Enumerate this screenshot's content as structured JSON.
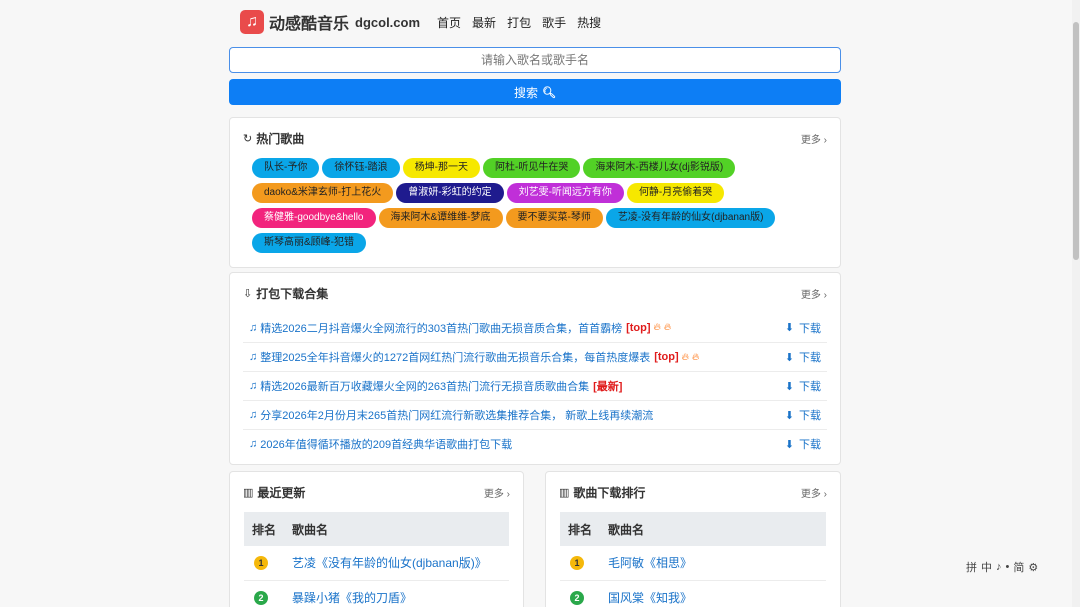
{
  "header": {
    "logo_icon": "music-note-icon",
    "logo_glyph": "♫",
    "site_name": "动感酷音乐",
    "domain": "dgcol.com",
    "nav": [
      "首页",
      "最新",
      "打包",
      "歌手",
      "热搜"
    ]
  },
  "search": {
    "placeholder": "请输入歌名或歌手名",
    "button_label": "搜索"
  },
  "hot_songs": {
    "title": "热门歌曲",
    "more": "更多",
    "tags": [
      {
        "label": "队长-予你",
        "color": "#0aa6e8"
      },
      {
        "label": "徐怀钰-踏浪",
        "color": "#0aa6e8"
      },
      {
        "label": "杨坤-那一天",
        "color": "#f6e800"
      },
      {
        "label": "阿杜-听见牛在哭",
        "color": "#52d126"
      },
      {
        "label": "海来阿木-西楼儿女(dj影锐版)",
        "color": "#52d126"
      },
      {
        "label": "daoko&米津玄师-打上花火",
        "color": "#f39a1e"
      },
      {
        "label": "曾淑妍-彩虹的约定",
        "color": "#1f1b8e"
      },
      {
        "label": "刘艺雯-听闻远方有你",
        "color": "#c02fd8"
      },
      {
        "label": "何静-月亮偷着哭",
        "color": "#f6e800"
      },
      {
        "label": "蔡健雅-goodbye&hello",
        "color": "#f2247d"
      },
      {
        "label": "海来阿木&谭维维-梦底",
        "color": "#f39a1e"
      },
      {
        "label": "要不要买菜-琴师",
        "color": "#f39a1e"
      },
      {
        "label": "艺凌-没有年龄的仙女(djbanan版)",
        "color": "#0aa6e8"
      },
      {
        "label": "斯琴高丽&顾峰-犯错",
        "color": "#0aa6e8"
      }
    ]
  },
  "packs": {
    "title": "打包下载合集",
    "more": "更多",
    "download_label": "下载",
    "items": [
      {
        "title": "精选2026二月抖音爆火全网流行的303首热门歌曲无损音质合集，首首霸榜",
        "badge": "[top]",
        "fire": true
      },
      {
        "title": "整理2025全年抖音爆火的1272首网红热门流行歌曲无损音乐合集，每首热度爆表",
        "badge": "[top]",
        "fire": true
      },
      {
        "title": "精选2026最新百万收藏爆火全网的263首热门流行无损音质歌曲合集",
        "badge": "[最新]",
        "fire": false
      },
      {
        "title": "分享2026年2月份月末265首热门网红流行新歌选集推荐合集， 新歌上线再续潮流",
        "badge": "",
        "fire": false
      },
      {
        "title": "2026年值得循环播放的209首经典华语歌曲打包下载",
        "badge": "",
        "fire": false
      }
    ]
  },
  "recent": {
    "title": "最近更新",
    "more": "更多",
    "col_rank": "排名",
    "col_song": "歌曲名",
    "rows": [
      {
        "rank": "1",
        "song": "艺凌《没有年龄的仙女(djbanan版)》",
        "badge_color": "#f5b80a"
      },
      {
        "rank": "2",
        "song": "暴躁小猪《我的刀盾》",
        "badge_color": "#2aa84a"
      }
    ]
  },
  "ranking": {
    "title": "歌曲下载排行",
    "more": "更多",
    "col_rank": "排名",
    "col_song": "歌曲名",
    "rows": [
      {
        "rank": "1",
        "song": "毛阿敏《相思》",
        "badge_color": "#f5b80a"
      },
      {
        "rank": "2",
        "song": "国风棠《知我》",
        "badge_color": "#2aa84a"
      }
    ]
  },
  "ime_toolbar": [
    "拼",
    "中",
    "♪",
    "•",
    "简",
    "⚙"
  ]
}
